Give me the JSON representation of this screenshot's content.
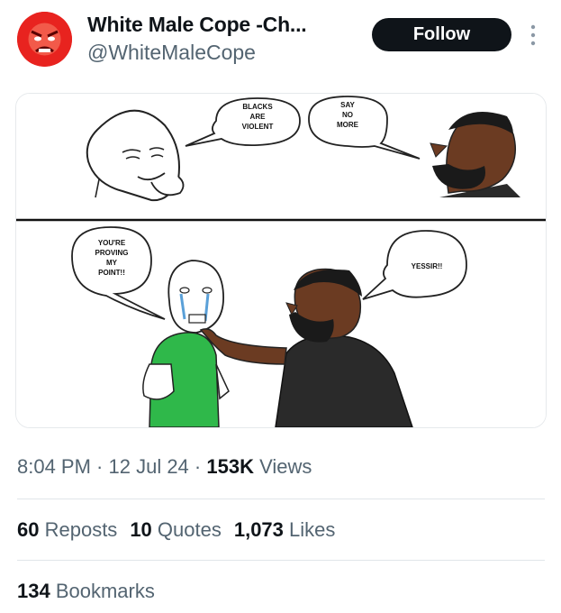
{
  "author": {
    "display_name": "White Male Cope -Ch...",
    "handle": "@WhiteMaleCope",
    "avatar_icon": "angry-red-face-avatar"
  },
  "header": {
    "follow_label": "Follow",
    "more_icon": "vertical-ellipsis-icon"
  },
  "media": {
    "panel1": {
      "bubble_left": [
        "BLACKS",
        "ARE",
        "VIOLENT"
      ],
      "bubble_right": [
        "SAY",
        "NO",
        "MORE"
      ]
    },
    "panel2": {
      "bubble_left": [
        "YOU'RE",
        "PROVING",
        "MY",
        "POINT!!"
      ],
      "bubble_right": [
        "YESSIR!!"
      ]
    }
  },
  "meta": {
    "time": "8:04 PM",
    "sep1": " · ",
    "date": "12 Jul 24",
    "sep2": " · ",
    "views_count": "153K",
    "views_label": " Views"
  },
  "stats": {
    "reposts_count": "60",
    "reposts_label": " Reposts",
    "quotes_count": "10",
    "quotes_label": " Quotes",
    "likes_count": "1,073",
    "likes_label": " Likes",
    "bookmarks_count": "134",
    "bookmarks_label": " Bookmarks"
  },
  "colors": {
    "follow_bg": "#0f1419",
    "secondary_text": "#536471",
    "avatar_red": "#e8231f",
    "shirt_green": "#2fb84a",
    "shirt_black": "#2a2a2a",
    "skin_dark": "#6b3b22"
  }
}
